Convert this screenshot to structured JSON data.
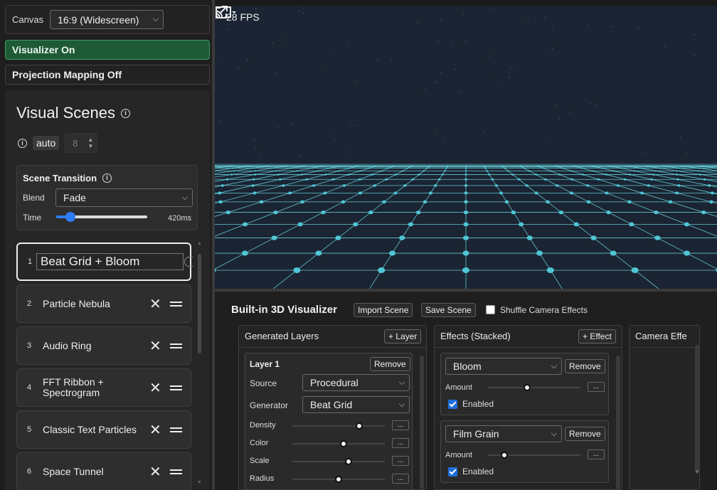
{
  "canvas": {
    "label": "Canvas",
    "aspect": "16:9 (Widescreen)"
  },
  "toggles": {
    "visualizer": "Visualizer On",
    "projection": "Projection Mapping Off"
  },
  "scenes": {
    "title": "Visual Scenes",
    "auto_label": "auto",
    "auto_value": "8",
    "transition": {
      "title": "Scene Transition",
      "blend_label": "Blend",
      "blend_value": "Fade",
      "time_label": "Time",
      "time_value": "420ms",
      "time_fraction": 0.16
    },
    "items": [
      {
        "index": "1",
        "name": "Beat Grid + Bloom",
        "active": true
      },
      {
        "index": "2",
        "name": "Particle Nebula",
        "active": false
      },
      {
        "index": "3",
        "name": "Audio Ring",
        "active": false
      },
      {
        "index": "4",
        "name": "FFT Ribbon + Spectrogram",
        "active": false
      },
      {
        "index": "5",
        "name": "Classic Text Particles",
        "active": false
      },
      {
        "index": "6",
        "name": "Space Tunnel",
        "active": false
      }
    ]
  },
  "viewport": {
    "fps": "28 FPS",
    "grid_color": "#6fe3ee"
  },
  "visualizer": {
    "title": "Built-in 3D Visualizer",
    "import_label": "Import Scene",
    "save_label": "Save Scene",
    "shuffle_label": "Shuffle Camera Effects",
    "shuffle_checked": false,
    "layers": {
      "header": "Generated Layers",
      "add_label": "+ Layer",
      "layer": {
        "name": "Layer 1",
        "remove_label": "Remove",
        "source_label": "Source",
        "source_value": "Procedural",
        "generator_label": "Generator",
        "generator_value": "Beat Grid",
        "params": [
          {
            "label": "Density",
            "value": 0.72
          },
          {
            "label": "Color",
            "value": 0.55
          },
          {
            "label": "Scale",
            "value": 0.61
          },
          {
            "label": "Radius",
            "value": 0.5
          }
        ]
      }
    },
    "effects": {
      "header": "Effects (Stacked)",
      "add_label": "+ Effect",
      "items": [
        {
          "name": "Bloom",
          "remove_label": "Remove",
          "amount_label": "Amount",
          "amount": 0.42,
          "enabled_label": "Enabled",
          "enabled": true
        },
        {
          "name": "Film Grain",
          "remove_label": "Remove",
          "amount_label": "Amount",
          "amount": 0.18,
          "enabled_label": "Enabled",
          "enabled": true
        }
      ]
    },
    "camera": {
      "header": "Camera Effe"
    }
  },
  "dots_label": "..."
}
